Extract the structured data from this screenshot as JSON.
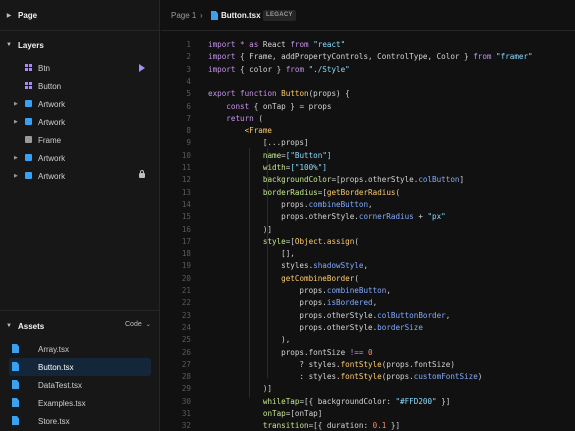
{
  "sidebar": {
    "page_section": "Page",
    "layers_section": "Layers",
    "assets_section": "Assets",
    "assets_toggle": "Code",
    "layers": [
      {
        "label": "Btn",
        "icon": "component-grid-icon",
        "expandable": false,
        "badge": "play-icon"
      },
      {
        "label": "Button",
        "icon": "component-grid-icon",
        "expandable": false,
        "badge": ""
      },
      {
        "label": "Artwork",
        "icon": "frame-square-icon",
        "expandable": true,
        "badge": ""
      },
      {
        "label": "Artwork",
        "icon": "frame-square-icon",
        "expandable": true,
        "badge": ""
      },
      {
        "label": "Frame",
        "icon": "frame-square-icon",
        "expandable": false,
        "badge": ""
      },
      {
        "label": "Artwork",
        "icon": "frame-square-icon",
        "expandable": true,
        "badge": ""
      },
      {
        "label": "Artwork",
        "icon": "frame-square-icon",
        "expandable": true,
        "badge": "lock-icon"
      }
    ],
    "files": [
      {
        "label": "Array.tsx",
        "active": false
      },
      {
        "label": "Button.tsx",
        "active": true
      },
      {
        "label": "DataTest.tsx",
        "active": false
      },
      {
        "label": "Examples.tsx",
        "active": false
      },
      {
        "label": "Store.tsx",
        "active": false
      }
    ]
  },
  "editor": {
    "breadcrumb_page": "Page 1",
    "breadcrumb_file": "Button.tsx",
    "badge": "LEGACY",
    "lines": [
      [
        [
          "kw",
          "import "
        ],
        [
          "kw",
          "* "
        ],
        [
          "kw",
          "as "
        ],
        [
          "plain",
          "React "
        ],
        [
          "kw",
          "from "
        ],
        [
          "str",
          "\"react\""
        ]
      ],
      [
        [
          "kw",
          "import "
        ],
        [
          "plain",
          "{ Frame, addPropertyControls, ControlType, Color } "
        ],
        [
          "kw",
          "from "
        ],
        [
          "str",
          "\"framer\""
        ]
      ],
      [
        [
          "kw",
          "import "
        ],
        [
          "plain",
          "{ color } "
        ],
        [
          "kw",
          "from "
        ],
        [
          "str",
          "\"./Style\""
        ]
      ],
      [],
      [
        [
          "kw",
          "export "
        ],
        [
          "kw",
          "function "
        ],
        [
          "fn",
          "Button"
        ],
        [
          "plain",
          "(props) {"
        ]
      ],
      [
        [
          "plain",
          "    "
        ],
        [
          "kw",
          "const "
        ],
        [
          "plain",
          "{ onTap } = props"
        ]
      ],
      [
        [
          "plain",
          "    "
        ],
        [
          "kw",
          "return "
        ],
        [
          "plain",
          "("
        ]
      ],
      [
        [
          "plain",
          "        "
        ],
        [
          "tag",
          "<Frame"
        ]
      ],
      [
        [
          "plain",
          "            [...props]"
        ]
      ],
      [
        [
          "plain",
          "            "
        ],
        [
          "attr",
          "name"
        ],
        [
          "plain",
          "="
        ],
        [
          "str",
          "[\"Button\"]"
        ]
      ],
      [
        [
          "plain",
          "            "
        ],
        [
          "attr",
          "width"
        ],
        [
          "plain",
          "="
        ],
        [
          "str",
          "[\"100%\"]"
        ]
      ],
      [
        [
          "plain",
          "            "
        ],
        [
          "attr",
          "backgroundColor"
        ],
        [
          "plain",
          "=[props.otherStyle."
        ],
        [
          "prop",
          "colButton"
        ],
        [
          "plain",
          "]"
        ]
      ],
      [
        [
          "plain",
          "            "
        ],
        [
          "attr",
          "borderRadius"
        ],
        [
          "plain",
          "=["
        ],
        [
          "fn",
          "getBorderRadius"
        ],
        [
          "plain",
          "("
        ]
      ],
      [
        [
          "plain",
          "                props."
        ],
        [
          "prop",
          "combineButton"
        ],
        [
          "plain",
          ","
        ]
      ],
      [
        [
          "plain",
          "                props.otherStyle."
        ],
        [
          "prop",
          "cornerRadius"
        ],
        [
          "plain",
          " + "
        ],
        [
          "str",
          "\"px\""
        ]
      ],
      [
        [
          "plain",
          "            )]"
        ]
      ],
      [
        [
          "plain",
          "            "
        ],
        [
          "attr",
          "style"
        ],
        [
          "plain",
          "=["
        ],
        [
          "fn",
          "Object.assign"
        ],
        [
          "plain",
          "("
        ]
      ],
      [
        [
          "plain",
          "                [],"
        ]
      ],
      [
        [
          "plain",
          "                styles."
        ],
        [
          "prop",
          "shadowStyle"
        ],
        [
          "plain",
          ","
        ]
      ],
      [
        [
          "plain",
          "                "
        ],
        [
          "fn",
          "getCombineBorder"
        ],
        [
          "plain",
          "("
        ]
      ],
      [
        [
          "plain",
          "                    props."
        ],
        [
          "prop",
          "combineButton"
        ],
        [
          "plain",
          ","
        ]
      ],
      [
        [
          "plain",
          "                    props."
        ],
        [
          "prop",
          "isBordered"
        ],
        [
          "plain",
          ","
        ]
      ],
      [
        [
          "plain",
          "                    props.otherStyle."
        ],
        [
          "prop",
          "colButtonBorder"
        ],
        [
          "plain",
          ","
        ]
      ],
      [
        [
          "plain",
          "                    props.otherStyle."
        ],
        [
          "prop",
          "borderSize"
        ]
      ],
      [
        [
          "plain",
          "                ),"
        ]
      ],
      [
        [
          "plain",
          "                props.fontSize "
        ],
        [
          "kw",
          "!== "
        ],
        [
          "num2",
          "0"
        ]
      ],
      [
        [
          "plain",
          "                    ? styles."
        ],
        [
          "fn",
          "fontStyle"
        ],
        [
          "plain",
          "(props.fontSize)"
        ]
      ],
      [
        [
          "plain",
          "                    : styles."
        ],
        [
          "fn",
          "fontStyle"
        ],
        [
          "plain",
          "(props."
        ],
        [
          "prop",
          "customFontSize"
        ],
        [
          "plain",
          ")"
        ]
      ],
      [
        [
          "plain",
          "            )]"
        ]
      ],
      [
        [
          "plain",
          "            "
        ],
        [
          "attr",
          "whileTap"
        ],
        [
          "plain",
          "=[{ backgroundColor: "
        ],
        [
          "str",
          "\"#FFD200\""
        ],
        [
          "plain",
          " }]"
        ]
      ],
      [
        [
          "plain",
          "            "
        ],
        [
          "attr",
          "onTap"
        ],
        [
          "plain",
          "=[onTap]"
        ]
      ],
      [
        [
          "plain",
          "            "
        ],
        [
          "attr",
          "transition"
        ],
        [
          "plain",
          "=[{ duration: "
        ],
        [
          "num2",
          "0.1"
        ],
        [
          "plain",
          " }]"
        ]
      ]
    ]
  }
}
